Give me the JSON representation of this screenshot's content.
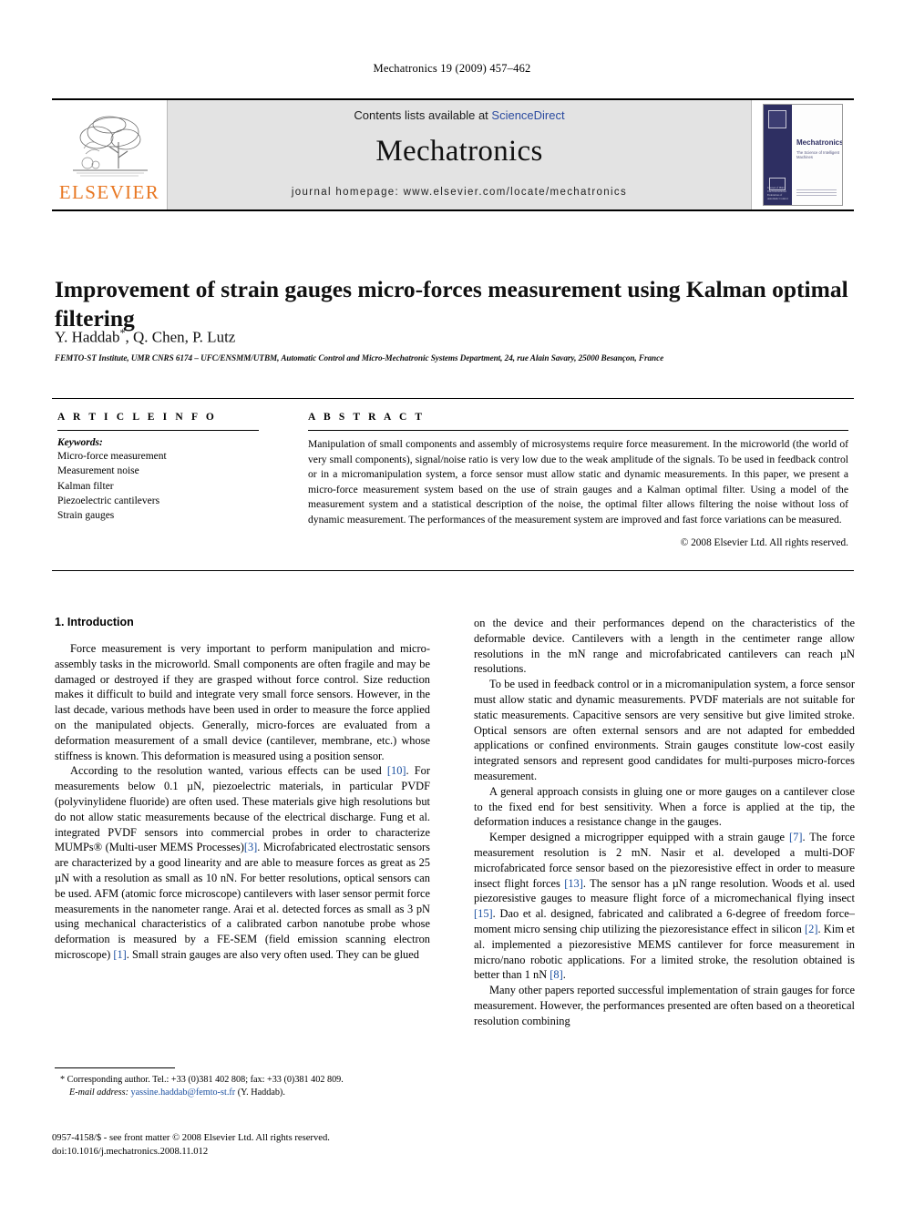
{
  "running_head": "Mechatronics 19 (2009) 457–462",
  "masthead": {
    "publisher_logo_label": "ELSEVIER",
    "contents_prefix": "Contents lists available at ",
    "contents_link": "ScienceDirect",
    "journal_name": "Mechatronics",
    "journal_homepage": "journal homepage: www.elsevier.com/locate/mechatronics",
    "cover": {
      "title": "Mechatronics",
      "subtitle": "The Science of Intelligent Machines",
      "foot": "Journal of IFAC\nThe International Federation\nof Automatic Control"
    }
  },
  "article": {
    "title": "Improvement of strain gauges micro-forces measurement using Kalman optimal filtering",
    "authors": "Y. Haddab",
    "authors_rest": ", Q. Chen, P. Lutz",
    "corresponding_marker": "*",
    "affiliation": "FEMTO-ST Institute, UMR CNRS 6174 – UFC/ENSMM/UTBM, Automatic Control and Micro-Mechatronic Systems Department, 24, rue Alain Savary, 25000 Besançon, France"
  },
  "info": {
    "heading": "A R T I C L E    I N F O",
    "keywords_label": "Keywords:",
    "keywords": [
      "Micro-force measurement",
      "Measurement noise",
      "Kalman filter",
      "Piezoelectric cantilevers",
      "Strain gauges"
    ]
  },
  "abstract": {
    "heading": "A B S T R A C T",
    "text": "Manipulation of small components and assembly of microsystems require force measurement. In the microworld (the world of very small components), signal/noise ratio is very low due to the weak amplitude of the signals. To be used in feedback control or in a micromanipulation system, a force sensor must allow static and dynamic measurements. In this paper, we present a micro-force measurement system based on the use of strain gauges and a Kalman optimal filter. Using a model of the measurement system and a statistical description of the noise, the optimal filter allows filtering the noise without loss of dynamic measurement. The performances of the measurement system are improved and fast force variations can be measured.",
    "copyright": "© 2008 Elsevier Ltd. All rights reserved."
  },
  "body": {
    "section_number_title": "1. Introduction",
    "left_paragraphs": [
      "Force measurement is very important to perform manipulation and micro-assembly tasks in the microworld. Small components are often fragile and may be damaged or destroyed if they are grasped without force control. Size reduction makes it difficult to build and integrate very small force sensors. However, in the last decade, various methods have been used in order to measure the force applied on the manipulated objects. Generally, micro-forces are evaluated from a deformation measurement of a small device (cantilever, membrane, etc.) whose stiffness is known. This deformation is measured using a position sensor.",
      "According to the resolution wanted, various effects can be used [10]. For measurements below 0.1 µN, piezoelectric materials, in particular PVDF (polyvinylidene fluoride) are often used. These materials give high resolutions but do not allow static measurements because of the electrical discharge. Fung et al. integrated PVDF sensors into commercial probes in order to characterize MUMPs® (Multi-user MEMS Processes)[3]. Microfabricated electrostatic sensors are characterized by a good linearity and are able to measure forces as great as 25 µN with a resolution as small as 10 nN. For better resolutions, optical sensors can be used. AFM (atomic force microscope) cantilevers with laser sensor permit force measurements in the nanometer range. Arai et al. detected forces as small as 3 pN using mechanical characteristics of a calibrated carbon nanotube probe whose deformation is measured by a FE-SEM (field emission scanning electron microscope) [1]. Small strain gauges are also very often used. They can be glued"
    ],
    "right_paragraphs": [
      "on the device and their performances depend on the characteristics of the deformable device. Cantilevers with a length in the centimeter range allow resolutions in the mN range and microfabricated cantilevers can reach µN resolutions.",
      "To be used in feedback control or in a micromanipulation system, a force sensor must allow static and dynamic measurements. PVDF materials are not suitable for static measurements. Capacitive sensors are very sensitive but give limited stroke. Optical sensors are often external sensors and are not adapted for embedded applications or confined environments. Strain gauges constitute low-cost easily integrated sensors and represent good candidates for multi-purposes micro-forces measurement.",
      "A general approach consists in gluing one or more gauges on a cantilever close to the fixed end for best sensitivity. When a force is applied at the tip, the deformation induces a resistance change in the gauges.",
      "Kemper designed a microgripper equipped with a strain gauge [7]. The force measurement resolution is 2 mN. Nasir et al. developed a multi-DOF microfabricated force sensor based on the piezoresistive effect in order to measure insect flight forces [13]. The sensor has a µN range resolution. Woods et al. used piezoresistive gauges to measure flight force of a micromechanical flying insect [15]. Dao et al. designed, fabricated and calibrated a 6-degree of freedom force–moment micro sensing chip utilizing the piezoresistance effect in silicon [2]. Kim et al. implemented a piezoresistive MEMS cantilever for force measurement in micro/nano robotic applications. For a limited stroke, the resolution obtained is better than 1 nN [8].",
      "Many other papers reported successful implementation of strain gauges for force measurement. However, the performances presented are often based on a theoretical resolution combining"
    ]
  },
  "footnote": {
    "marker": "*",
    "text": "Corresponding author. Tel.: +33 (0)381 402 808; fax: +33 (0)381 402 809.",
    "email_label": "E-mail address:",
    "email": "yassine.haddab@femto-st.fr",
    "email_suffix": " (Y. Haddab)."
  },
  "imprint": {
    "line1": "0957-4158/$ - see front matter © 2008 Elsevier Ltd. All rights reserved.",
    "line2": "doi:10.1016/j.mechatronics.2008.11.012"
  },
  "colors": {
    "link_blue": "#2B4BA0",
    "cite_blue": "#1a4fa0",
    "elsevier_orange": "#E87722",
    "masthead_grey": "#e3e3e3",
    "cover_navy": "#2e2f62"
  }
}
